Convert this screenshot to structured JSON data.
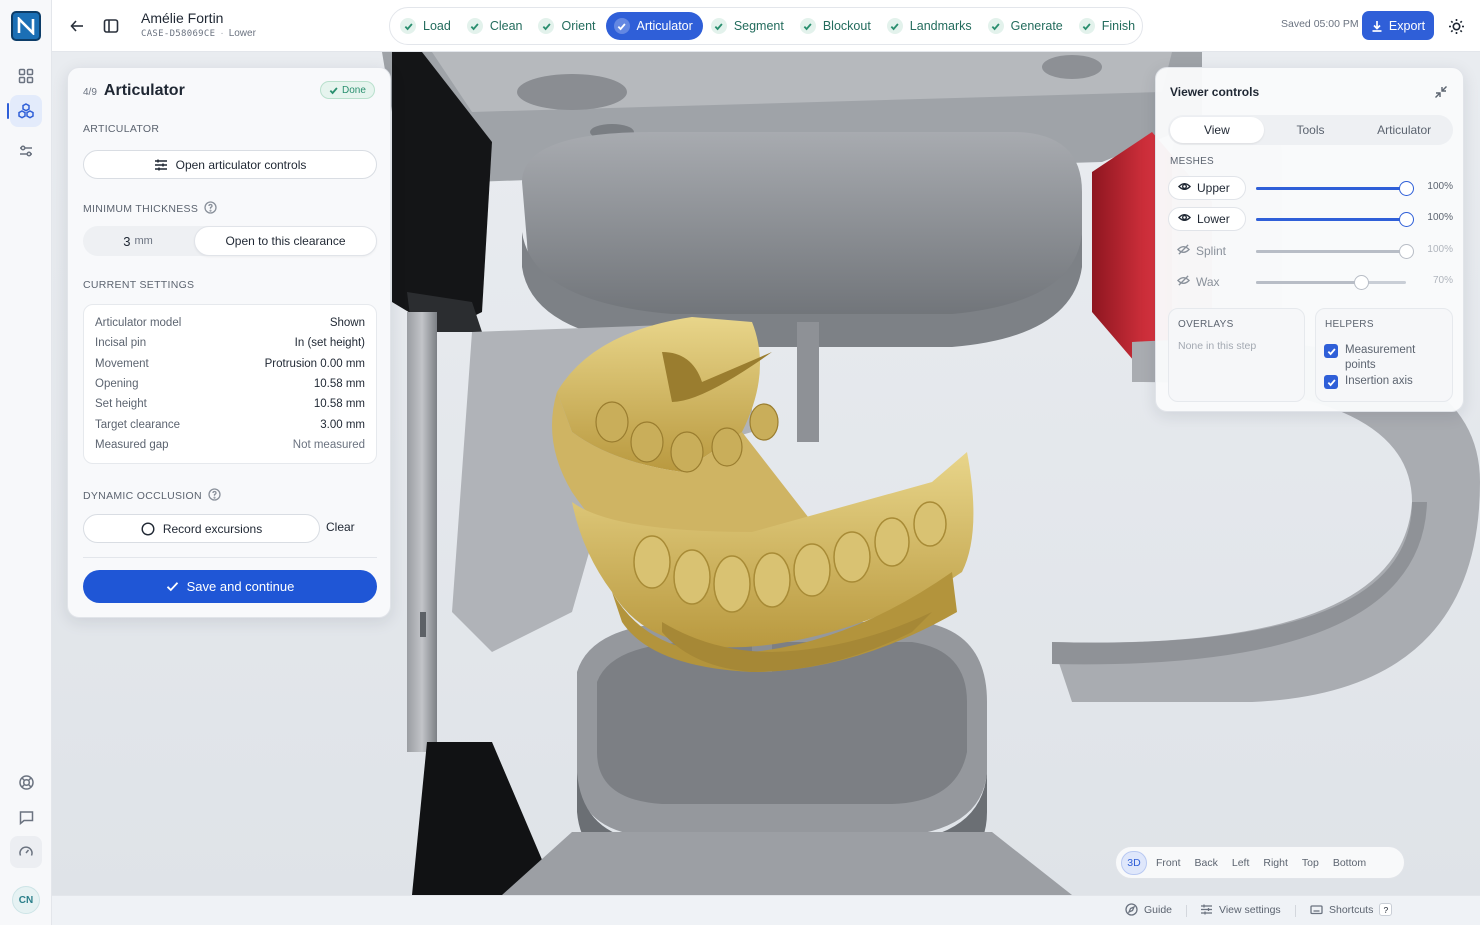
{
  "app": {
    "brand_color": "#2f5fd8",
    "logo_icon": "n-logo-icon"
  },
  "patient": {
    "name": "Amélie Fortin",
    "case_id": "CASE-D58069CE",
    "arch": "Lower"
  },
  "steps": [
    {
      "label": "Load",
      "state": "done"
    },
    {
      "label": "Clean",
      "state": "done"
    },
    {
      "label": "Orient",
      "state": "done"
    },
    {
      "label": "Articulator",
      "state": "active"
    },
    {
      "label": "Segment",
      "state": "done"
    },
    {
      "label": "Blockout",
      "state": "done"
    },
    {
      "label": "Landmarks",
      "state": "done"
    },
    {
      "label": "Generate",
      "state": "done"
    },
    {
      "label": "Finish",
      "state": "done"
    }
  ],
  "header": {
    "saved_text": "Saved 05:00 PM",
    "export_label": "Export"
  },
  "panel": {
    "step_count": "4/9",
    "title": "Articulator",
    "status_badge": "Done",
    "articulator_label": "ARTICULATOR",
    "open_controls_label": "Open articulator controls",
    "min_thickness_label": "MINIMUM THICKNESS",
    "thickness_value": "3",
    "thickness_unit": "mm",
    "open_clearance_label": "Open to this clearance",
    "current_settings_label": "CURRENT SETTINGS",
    "settings": [
      {
        "key": "Articulator model",
        "value": "Shown"
      },
      {
        "key": "Incisal pin",
        "value": "In (set height)"
      },
      {
        "key": "Movement",
        "value": "Protrusion 0.00 mm"
      },
      {
        "key": "Opening",
        "value": "10.58 mm"
      },
      {
        "key": "Set height",
        "value": "10.58 mm"
      },
      {
        "key": "Target clearance",
        "value": "3.00 mm"
      },
      {
        "key": "Measured gap",
        "value": "Not measured"
      }
    ],
    "dynamic_occlusion_label": "DYNAMIC OCCLUSION",
    "record_label": "Record excursions",
    "clear_label": "Clear",
    "save_label": "Save and continue"
  },
  "viewer_controls": {
    "title": "Viewer controls",
    "tabs": [
      "View",
      "Tools",
      "Articulator"
    ],
    "active_tab": "View",
    "meshes_label": "MESHES",
    "meshes": [
      {
        "name": "Upper",
        "visible": true,
        "opacity": 1.0,
        "pct_label": "100%"
      },
      {
        "name": "Lower",
        "visible": true,
        "opacity": 1.0,
        "pct_label": "100%"
      },
      {
        "name": "Splint",
        "visible": false,
        "opacity": 1.0,
        "pct_label": "100%"
      },
      {
        "name": "Wax",
        "visible": false,
        "opacity": 0.7,
        "pct_label": "70%"
      }
    ],
    "overlays_label": "OVERLAYS",
    "overlays_empty": "None in this step",
    "helpers_label": "HELPERS",
    "helpers": [
      {
        "label": "Measurement points",
        "checked": true
      },
      {
        "label": "Insertion axis",
        "checked": true
      }
    ]
  },
  "view_presets": {
    "items": [
      "3D",
      "Front",
      "Back",
      "Left",
      "Right",
      "Top",
      "Bottom"
    ],
    "active": "3D"
  },
  "footer": {
    "guide_label": "Guide",
    "view_settings_label": "View settings",
    "shortcuts_label": "Shortcuts",
    "shortcut_key": "?"
  },
  "user": {
    "initials": "CN"
  }
}
